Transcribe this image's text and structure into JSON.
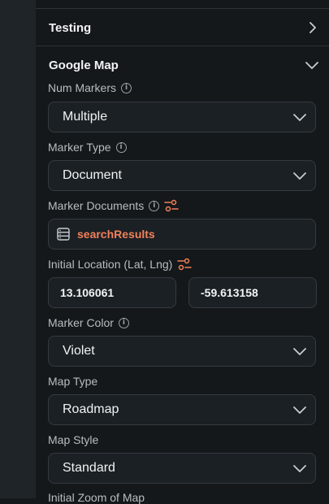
{
  "sections": {
    "testing": {
      "title": "Testing",
      "icon": "chevron-right-icon"
    },
    "google_map": {
      "title": "Google Map",
      "icon": "chevron-down-icon"
    }
  },
  "fields": {
    "num_markers": {
      "label": "Num Markers",
      "value": "Multiple"
    },
    "marker_type": {
      "label": "Marker Type",
      "value": "Document"
    },
    "marker_documents": {
      "label": "Marker Documents",
      "value": "searchResults"
    },
    "initial_location": {
      "label": "Initial Location (Lat, Lng)",
      "lat": "13.106061",
      "lng": "-59.613158"
    },
    "marker_color": {
      "label": "Marker Color",
      "value": "Violet"
    },
    "map_type": {
      "label": "Map Type",
      "value": "Roadmap"
    },
    "map_style": {
      "label": "Map Style",
      "value": "Standard"
    },
    "initial_zoom": {
      "label": "Initial Zoom of Map"
    }
  },
  "colors": {
    "background": "#14181b",
    "rail": "#1e2428",
    "accent": "#f2815a",
    "border": "#343b40"
  },
  "icons": {
    "info": "info-icon",
    "variable": "variable-settings-icon",
    "database": "database-icon"
  }
}
